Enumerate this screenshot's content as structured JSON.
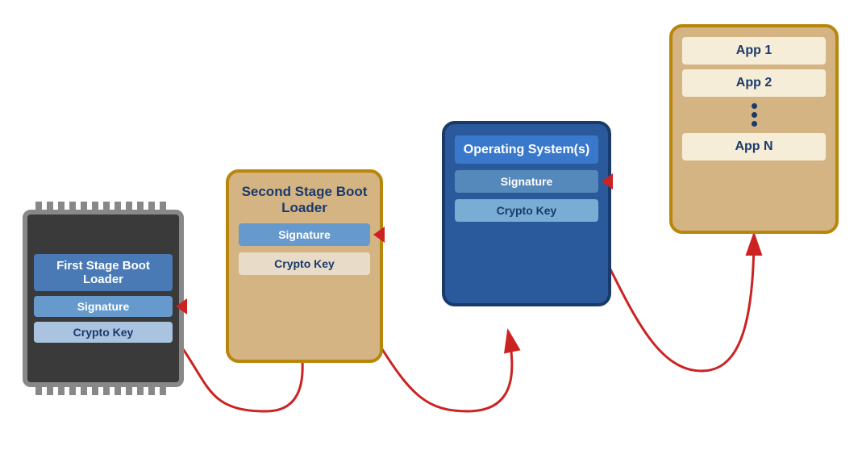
{
  "chip": {
    "title": "First Stage Boot Loader",
    "signature": "Signature",
    "crypto_key": "Crypto Key"
  },
  "ssbl": {
    "title": "Second Stage Boot Loader",
    "signature": "Signature",
    "crypto_key": "Crypto Key"
  },
  "os": {
    "title": "Operating System(s)",
    "signature": "Signature",
    "crypto_key": "Crypto Key"
  },
  "apps": {
    "app1": "App 1",
    "app2": "App 2",
    "appN": "App N"
  }
}
